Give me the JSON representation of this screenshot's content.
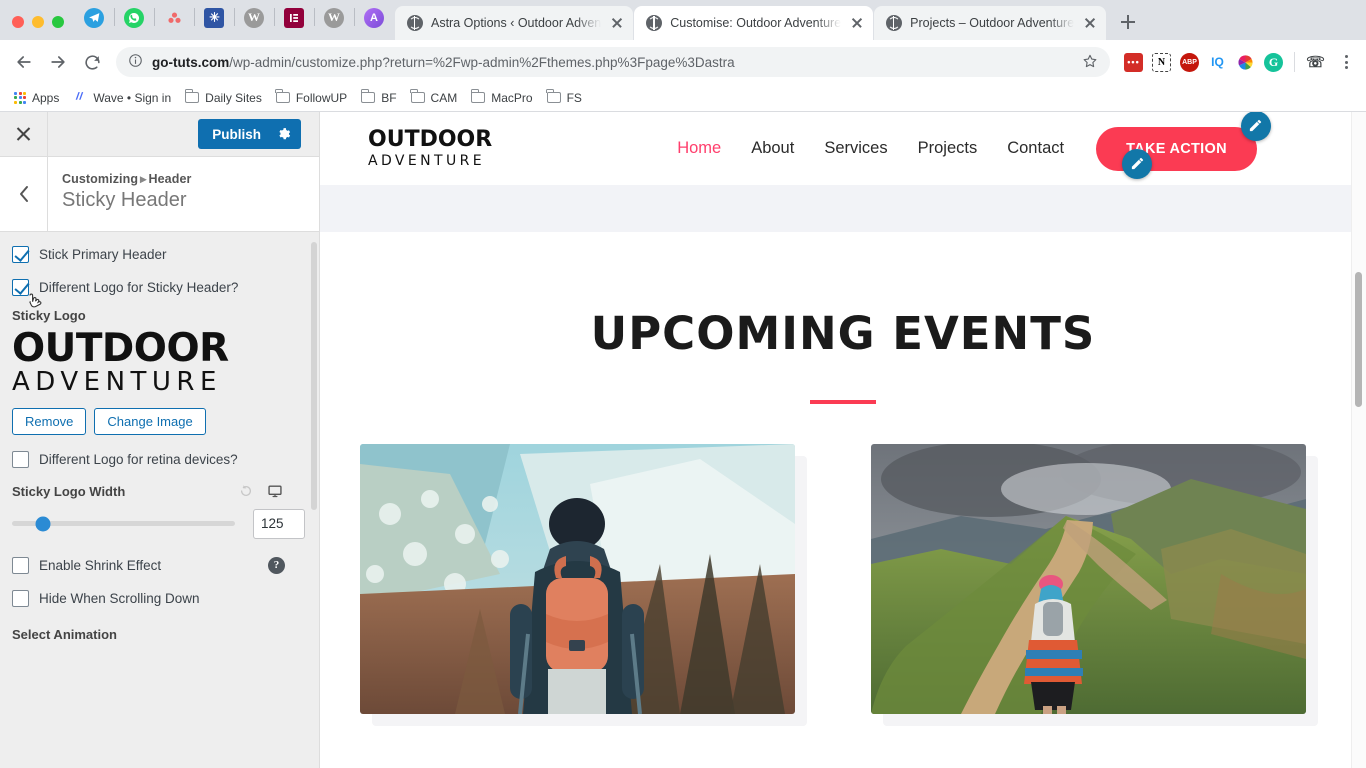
{
  "browser": {
    "pinned_tabs": [
      {
        "name": "telegram-pinned-tab",
        "color": "#2ba0e0",
        "glyph": "➤"
      },
      {
        "name": "whatsapp-pinned-tab",
        "color": "#25d366",
        "glyph": "✆"
      },
      {
        "name": "asana-pinned-tab",
        "color": "#f06a6a",
        "glyph": "∴"
      },
      {
        "name": "app-pinned-tab",
        "color": "#2f55a4",
        "glyph": "✚"
      },
      {
        "name": "wordpress-pinned-tab",
        "color": "#9a9a9a",
        "glyph": "W"
      },
      {
        "name": "elementor-pinned-tab",
        "color": "#92003b",
        "glyph": "≡"
      },
      {
        "name": "wordpress-2-pinned-tab",
        "color": "#9a9a9a",
        "glyph": "W"
      },
      {
        "name": "astra-pinned-tab",
        "color": "#a855f7",
        "glyph": "A"
      }
    ],
    "tabs": [
      {
        "title": "Astra Options ‹ Outdoor Adven",
        "active": false
      },
      {
        "title": "Customise: Outdoor Adventure",
        "active": true
      },
      {
        "title": "Projects – Outdoor Adventure",
        "active": false
      }
    ],
    "new_tab_label": "+",
    "omnibox": {
      "host": "go-tuts.com",
      "path": "/wp-admin/customize.php?return=%2Fwp-admin%2Fthemes.php%3Fpage%3Dastra",
      "info_icon": "ⓘ"
    },
    "extensions": [
      {
        "name": "lastpass-extension-icon",
        "label": "•••",
        "color": "#d32d27"
      },
      {
        "name": "notion-extension-icon",
        "label": "N",
        "color": "#ffffff"
      },
      {
        "name": "adblock-plus-extension-icon",
        "label": "ABP",
        "color": "#c4170c"
      },
      {
        "name": "iq-extension-icon",
        "label": "IQ",
        "color": "#2196f3"
      },
      {
        "name": "color-picker-extension-icon",
        "label": "◕",
        "color": "#ff9800"
      },
      {
        "name": "grammarly-extension-icon",
        "label": "G",
        "color": "#15c39a"
      },
      {
        "name": "voice-extension-icon",
        "label": "☎",
        "color": "#3c4043"
      }
    ],
    "bookmarks": [
      {
        "label": "Apps",
        "icon": "apps-grid-icon"
      },
      {
        "label": "Wave • Sign in",
        "icon": "wave-icon"
      },
      {
        "label": "Daily Sites",
        "icon": "folder-icon"
      },
      {
        "label": "FollowUP",
        "icon": "folder-icon"
      },
      {
        "label": "BF",
        "icon": "folder-icon"
      },
      {
        "label": "CAM",
        "icon": "folder-icon"
      },
      {
        "label": "MacPro",
        "icon": "folder-icon"
      },
      {
        "label": "FS",
        "icon": "folder-icon"
      }
    ]
  },
  "customizer": {
    "publish_label": "Publish",
    "breadcrumb_parent": "Customizing",
    "breadcrumb_separator": "▸",
    "breadcrumb_current": "Header",
    "panel_title": "Sticky Header",
    "controls": {
      "stick_primary_header": {
        "label": "Stick Primary Header",
        "checked": true
      },
      "different_logo": {
        "label": "Different Logo for Sticky Header?",
        "checked": true
      },
      "sticky_logo_label": "Sticky Logo",
      "logo_line1": "OUTDOOR",
      "logo_line2": "ADVENTURE",
      "remove_label": "Remove",
      "change_image_label": "Change Image",
      "retina_logo": {
        "label": "Different Logo for retina devices?",
        "checked": false
      },
      "sticky_logo_width_label": "Sticky Logo Width",
      "sticky_logo_width_value": "125",
      "enable_shrink": {
        "label": "Enable Shrink Effect",
        "checked": false
      },
      "hide_when_scrolling": {
        "label": "Hide When Scrolling Down",
        "checked": false
      },
      "select_animation_label": "Select Animation",
      "help_glyph": "?"
    }
  },
  "site": {
    "logo_line1": "OUTDOOR",
    "logo_line2": "ADVENTURE",
    "nav": [
      {
        "label": "Home",
        "current": true
      },
      {
        "label": "About",
        "current": false
      },
      {
        "label": "Services",
        "current": false
      },
      {
        "label": "Projects",
        "current": false
      },
      {
        "label": "Contact",
        "current": false
      }
    ],
    "cta_label": "TAKE ACTION",
    "section_title": "UPCOMING EVENTS",
    "accent_color": "#fb3b53"
  }
}
